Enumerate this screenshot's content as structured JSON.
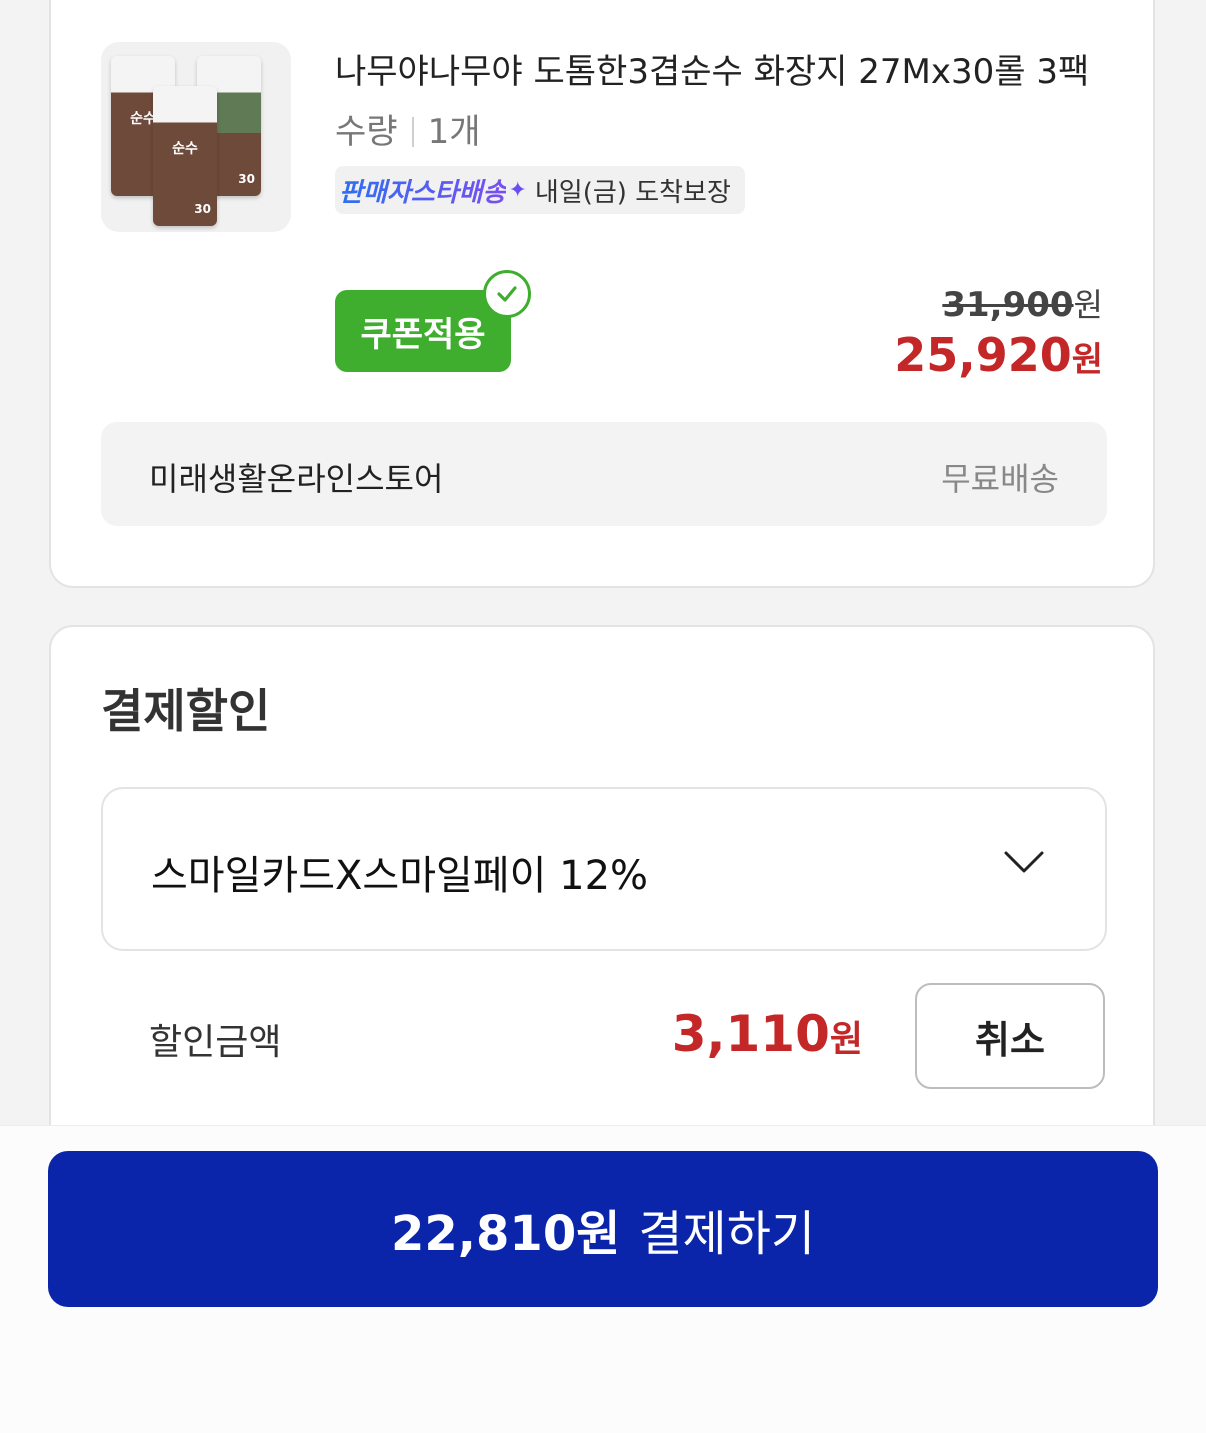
{
  "product": {
    "title": "나무야나무야 도톰한3겹순수 화장지 27Mx30롤 3팩",
    "quantity_label": "수량",
    "quantity_value": "1개",
    "delivery_brand": "판매자스타배송",
    "delivery_text": "내일(금) 도착보장",
    "coupon_label": "쿠폰적용",
    "original_price": "31,900",
    "sale_price": "25,920",
    "won": "원",
    "seller_name": "미래생활온라인스토어",
    "shipping": "무료배송",
    "thumb_pack_label": "순수",
    "thumb_pack_count": "30"
  },
  "discount": {
    "section_title": "결제할인",
    "selected_card": "스마일카드X스마일페이 12%",
    "amount_label": "할인금액",
    "amount": "3,110",
    "won": "원",
    "cancel_label": "취소"
  },
  "checkout": {
    "amount": "22,810원",
    "label": "결제하기"
  },
  "colors": {
    "sale_red": "#c32727",
    "coupon_green": "#3fae2f",
    "pay_blue": "#0a25a9"
  }
}
